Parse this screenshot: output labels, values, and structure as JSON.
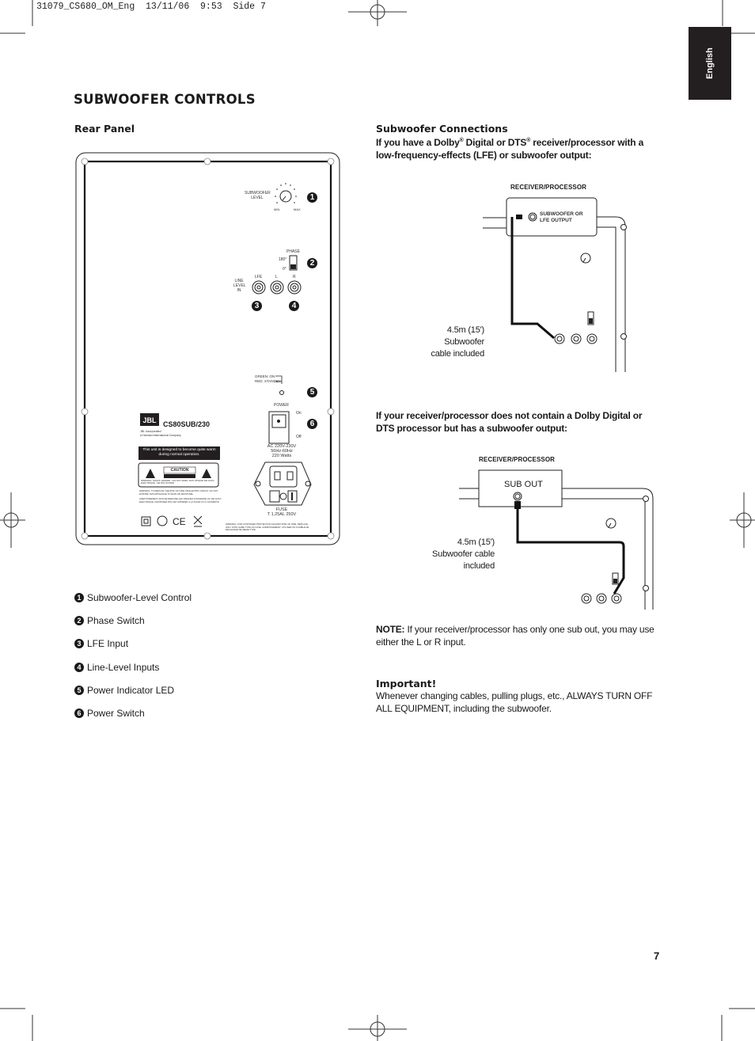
{
  "slug": "31079_CS680_OM_Eng  13/11/06  9:53  Side 7",
  "language_tab": "English",
  "title": "SUBWOOFER CONTROLS",
  "rear_panel": {
    "heading": "Rear Panel",
    "panel_labels": {
      "subwoofer_level": "SUBWOOFER LEVEL",
      "min": "MIN",
      "max": "MAX",
      "phase": "PHASE",
      "phase_180": "180°",
      "phase_0": "0°",
      "line_level_in": "LINE LEVEL IN",
      "lfe": "LFE",
      "l": "L",
      "r": "R",
      "led_green": "GREEN: ON",
      "led_red": "RED: STANDBY",
      "power": "POWER",
      "on": "On",
      "off": "Off",
      "ac_line1": "AC 220V-230V",
      "ac_line2": "50Hz-60Hz",
      "ac_line3": "220 Watts",
      "fuse_line1": "FUSE",
      "fuse_line2": "T 1.25AL 250V",
      "brand": "JBL",
      "model": "CS80SUB/230",
      "company_line1": "JBL Incorporated",
      "company_line2": "A Harman International Company",
      "warm_notice": "This unit is designed to become quite warm during normal operation.",
      "caution": "CAUTION",
      "caution_sub": "RISK OF ELECTRIC SHOCK DO NOT OPEN",
      "warning_line": "WARNING: SHOCK HAZARD - DO NOT OPEN.  AVIS: RISQUE DE CHOC ELECTRIQUE - NE PAS OUVRIR",
      "warning_fire": "WARNING: TO REDUCE THE RISK OF FIRE OR ELECTRIC SHOCK, DO NOT EXPOSE THIS APPLIANCE TO RAIN OR MOISTURE.",
      "avertissement": "AVERTISSEMENT: AFIN DE REDUIRE LES RISQUES D'INCENDIE OU DE CHOC ELECTRIQUE, N'EXPOSEZ PAS CET APPAREIL A LA PLUIE OU A L'HUMIDITE.",
      "fuse_warning": "WARNING: FOR CONTINUED PROTECTION AGAINST RISK OF FIRE, REPLACE ONLY WITH SAME TYPE OF FUSE. AVERTISSEMENT: UTILISER UN FUSIBLE DE RECHANGE DE MEME TYPE."
    },
    "callout_numbers": [
      "1",
      "2",
      "3",
      "4",
      "5",
      "6"
    ],
    "legend": [
      {
        "num": "1",
        "label": "Subwoofer-Level Control"
      },
      {
        "num": "2",
        "label": "Phase Switch"
      },
      {
        "num": "3",
        "label": "LFE Input"
      },
      {
        "num": "4",
        "label": "Line-Level Inputs"
      },
      {
        "num": "5",
        "label": "Power Indicator LED"
      },
      {
        "num": "6",
        "label": "Power Switch"
      }
    ]
  },
  "connections": {
    "heading": "Subwoofer Connections",
    "intro_lfe_a": "If you have a Dolby",
    "intro_lfe_b": " Digital or DTS",
    "intro_lfe_c": " receiver/processor with a low-frequency-effects (LFE) or subwoofer output:",
    "reg_mark": "®",
    "diagram1": {
      "receiver_label": "RECEIVER/PROCESSOR",
      "output_label_1": "SUBWOOFER OR",
      "output_label_2": "LFE OUTPUT",
      "cable_line1": "4.5m (15')",
      "cable_line2": "Subwoofer",
      "cable_line3": "cable included"
    },
    "intro_subout": "If your receiver/processor does not contain a Dolby Digital or DTS processor but has a subwoofer output:",
    "diagram2": {
      "receiver_label": "RECEIVER/PROCESSOR",
      "output_label": "SUB OUT",
      "cable_line1": "4.5m (15')",
      "cable_line2": "Subwoofer cable",
      "cable_line3": "included"
    },
    "note_label": "NOTE:",
    "note_text": " If your receiver/processor has only one sub out, you may use either the L or R input.",
    "important_heading": "Important!",
    "important_text": "Whenever changing cables, pulling plugs, etc., ALWAYS TURN OFF ALL EQUIPMENT, including the subwoofer."
  },
  "page_number": "7"
}
